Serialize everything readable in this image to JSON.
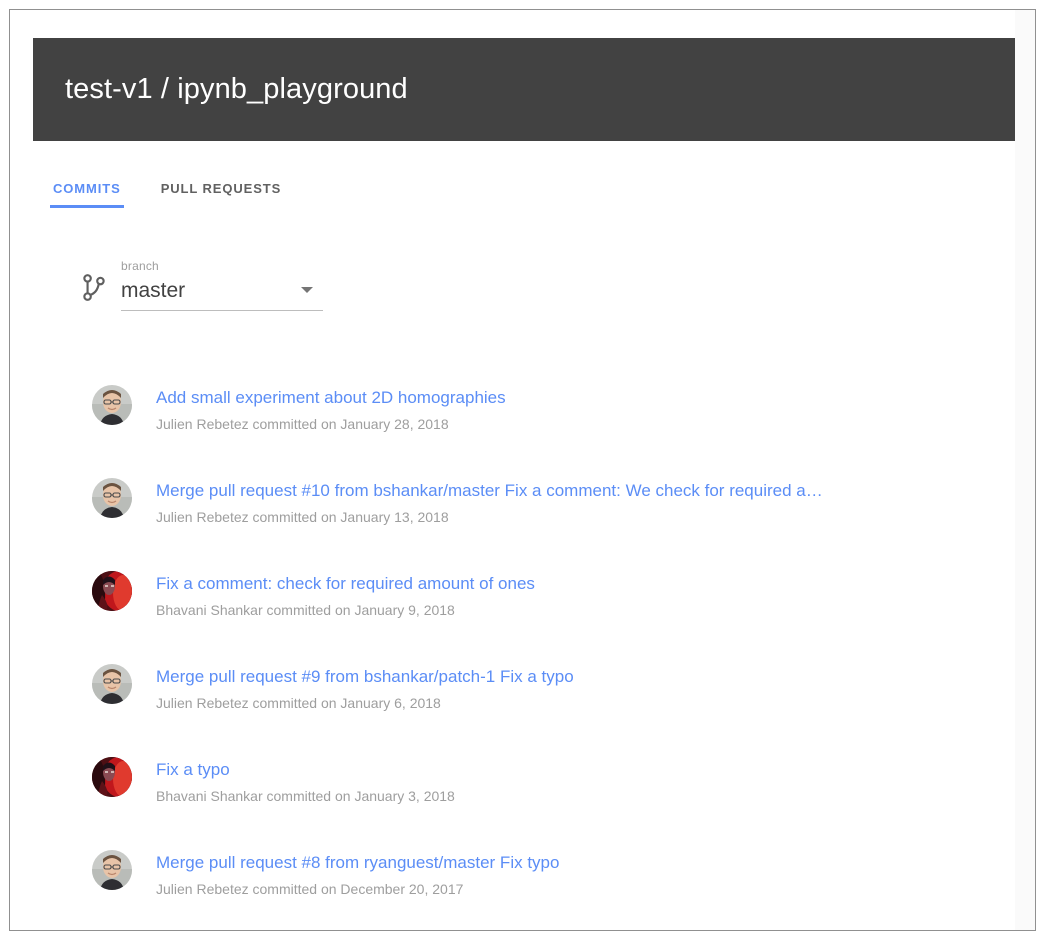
{
  "window": {
    "frame_border_color": "#909090",
    "page_background": "#fafafa",
    "surface_background": "#ffffff"
  },
  "header": {
    "title": "test-v1 / ipynb_playground",
    "background": "#424242",
    "text_color": "#ffffff"
  },
  "tabs": {
    "accent_color": "#5b8df6",
    "inactive_color": "#616161",
    "items": [
      {
        "label": "COMMITS",
        "active": true
      },
      {
        "label": "PULL REQUESTS",
        "active": false
      }
    ]
  },
  "branch_selector": {
    "icon": "git-branch-icon",
    "label": "branch",
    "value": "master",
    "caret_icon": "chevron-down-icon"
  },
  "commits": [
    {
      "message": "Add small experiment about 2D homographies",
      "meta": "Julien Rebetez committed on January 28, 2018",
      "author": "Julien Rebetez",
      "date": "January 28, 2018",
      "avatar": "julien-avatar"
    },
    {
      "message": "Merge pull request #10 from bshankar/master Fix a comment: We check for required a…",
      "meta": "Julien Rebetez committed on January 13, 2018",
      "author": "Julien Rebetez",
      "date": "January 13, 2018",
      "avatar": "julien-avatar"
    },
    {
      "message": "Fix a comment: check for required amount of ones",
      "meta": "Bhavani Shankar committed on January 9, 2018",
      "author": "Bhavani Shankar",
      "date": "January 9, 2018",
      "avatar": "bhavani-avatar"
    },
    {
      "message": "Merge pull request #9 from bshankar/patch-1 Fix a typo",
      "meta": "Julien Rebetez committed on January 6, 2018",
      "author": "Julien Rebetez",
      "date": "January 6, 2018",
      "avatar": "julien-avatar"
    },
    {
      "message": "Fix a typo",
      "meta": "Bhavani Shankar committed on January 3, 2018",
      "author": "Bhavani Shankar",
      "date": "January 3, 2018",
      "avatar": "bhavani-avatar"
    },
    {
      "message": "Merge pull request #8 from ryanguest/master Fix typo",
      "meta": "Julien Rebetez committed on December 20, 2017",
      "author": "Julien Rebetez",
      "date": "December 20, 2017",
      "avatar": "julien-avatar"
    }
  ]
}
